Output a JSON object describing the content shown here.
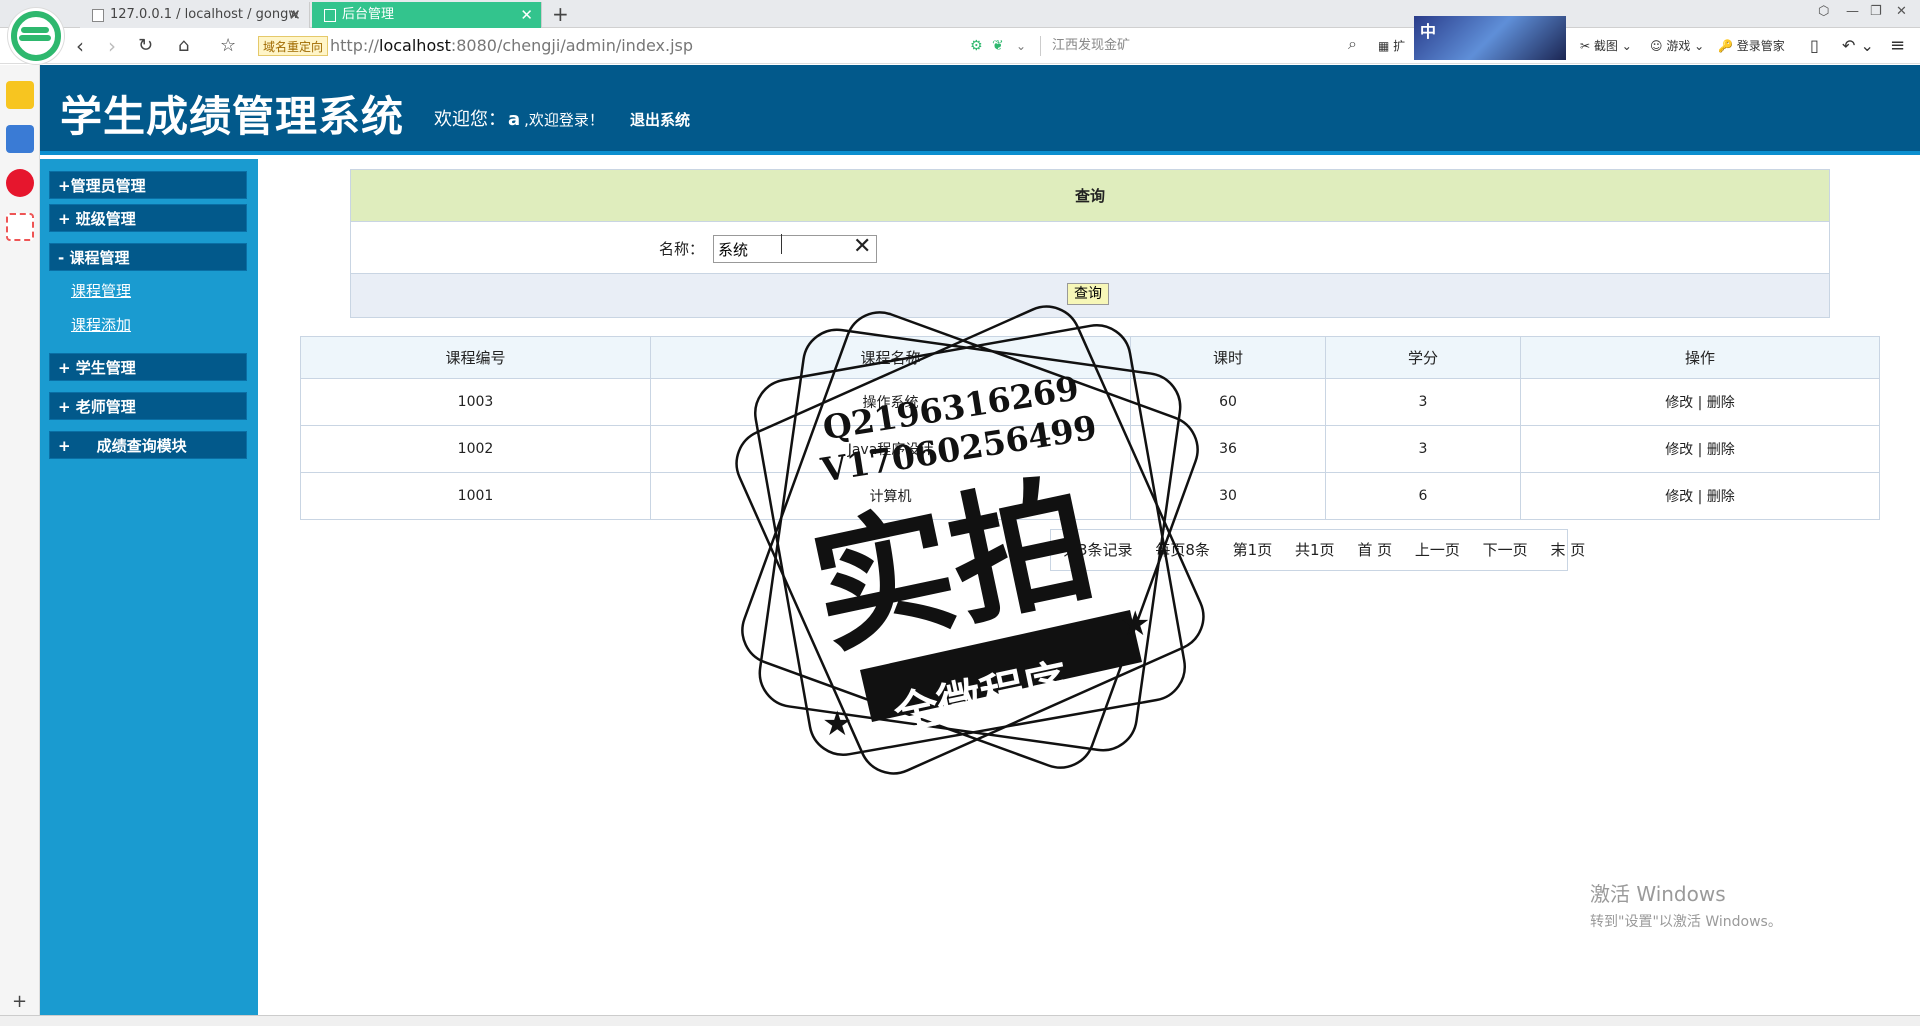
{
  "browser": {
    "tabs": [
      {
        "label": "127.0.0.1 / localhost / gongw",
        "close": "✕"
      },
      {
        "label": "后台管理",
        "close": "✕"
      }
    ],
    "new_tab": "+",
    "redirect_badge": "域名重定向",
    "url_prefix": "http://",
    "url_host": "localhost",
    "url_rest": ":8080/chengji/admin/index.jsp",
    "search_hint": "江西发现金矿",
    "ad_text": "中",
    "tools": [
      "扩",
      "截图",
      "游戏",
      "登录管家"
    ]
  },
  "header": {
    "title": "学生成绩管理系统",
    "welcome_prefix": "欢迎您：",
    "username": "a",
    "welcome_suffix": ",欢迎登录！",
    "logout": "退出系统"
  },
  "menu": {
    "groups": [
      {
        "label": "+管理员管理"
      },
      {
        "label": "+ 班级管理"
      },
      {
        "label": "- 课程管理"
      },
      {
        "label": "+ 学生管理"
      },
      {
        "label": "+ 老师管理"
      },
      {
        "label": "+     成绩查询模块"
      }
    ],
    "subitems": [
      "课程管理",
      "课程添加"
    ]
  },
  "query": {
    "header": "查询",
    "label": "名称：",
    "value": "系统",
    "clear": "✕",
    "button": "查询"
  },
  "table": {
    "headers": [
      "课程编号",
      "课程名称",
      "课时",
      "学分",
      "操作"
    ],
    "rows": [
      {
        "id": "1003",
        "name": "操作系统",
        "hours": "60",
        "credit": "3"
      },
      {
        "id": "1002",
        "name": "Java程序设计",
        "hours": "36",
        "credit": "3"
      },
      {
        "id": "1001",
        "name": "计算机",
        "hours": "30",
        "credit": "6"
      }
    ],
    "edit": "修改",
    "sep": "|",
    "delete": "删除"
  },
  "pager": {
    "total": "共3条记录",
    "per_page": "每页8条",
    "page": "第1页",
    "pages": "共1页",
    "first": "首 页",
    "prev": "上一页",
    "next": "下一页",
    "last": "末 页"
  },
  "watermark": {
    "line1": "Q2196316269",
    "line2": "V17060256499",
    "big": "实拍",
    "ribbon": "全微程序"
  },
  "activation": {
    "line1": "激活 Windows",
    "line2": "转到\"设置\"以激活 Windows。"
  }
}
